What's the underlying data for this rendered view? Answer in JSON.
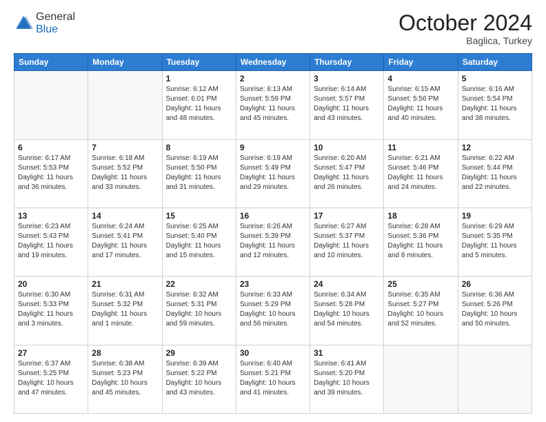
{
  "header": {
    "logo_general": "General",
    "logo_blue": "Blue",
    "month_title": "October 2024",
    "subtitle": "Baglica, Turkey"
  },
  "days_of_week": [
    "Sunday",
    "Monday",
    "Tuesday",
    "Wednesday",
    "Thursday",
    "Friday",
    "Saturday"
  ],
  "weeks": [
    [
      {
        "day": "",
        "sunrise": "",
        "sunset": "",
        "daylight": ""
      },
      {
        "day": "",
        "sunrise": "",
        "sunset": "",
        "daylight": ""
      },
      {
        "day": "1",
        "sunrise": "Sunrise: 6:12 AM",
        "sunset": "Sunset: 6:01 PM",
        "daylight": "Daylight: 11 hours and 48 minutes."
      },
      {
        "day": "2",
        "sunrise": "Sunrise: 6:13 AM",
        "sunset": "Sunset: 5:59 PM",
        "daylight": "Daylight: 11 hours and 45 minutes."
      },
      {
        "day": "3",
        "sunrise": "Sunrise: 6:14 AM",
        "sunset": "Sunset: 5:57 PM",
        "daylight": "Daylight: 11 hours and 43 minutes."
      },
      {
        "day": "4",
        "sunrise": "Sunrise: 6:15 AM",
        "sunset": "Sunset: 5:56 PM",
        "daylight": "Daylight: 11 hours and 40 minutes."
      },
      {
        "day": "5",
        "sunrise": "Sunrise: 6:16 AM",
        "sunset": "Sunset: 5:54 PM",
        "daylight": "Daylight: 11 hours and 38 minutes."
      }
    ],
    [
      {
        "day": "6",
        "sunrise": "Sunrise: 6:17 AM",
        "sunset": "Sunset: 5:53 PM",
        "daylight": "Daylight: 11 hours and 36 minutes."
      },
      {
        "day": "7",
        "sunrise": "Sunrise: 6:18 AM",
        "sunset": "Sunset: 5:52 PM",
        "daylight": "Daylight: 11 hours and 33 minutes."
      },
      {
        "day": "8",
        "sunrise": "Sunrise: 6:19 AM",
        "sunset": "Sunset: 5:50 PM",
        "daylight": "Daylight: 11 hours and 31 minutes."
      },
      {
        "day": "9",
        "sunrise": "Sunrise: 6:19 AM",
        "sunset": "Sunset: 5:49 PM",
        "daylight": "Daylight: 11 hours and 29 minutes."
      },
      {
        "day": "10",
        "sunrise": "Sunrise: 6:20 AM",
        "sunset": "Sunset: 5:47 PM",
        "daylight": "Daylight: 11 hours and 26 minutes."
      },
      {
        "day": "11",
        "sunrise": "Sunrise: 6:21 AM",
        "sunset": "Sunset: 5:46 PM",
        "daylight": "Daylight: 11 hours and 24 minutes."
      },
      {
        "day": "12",
        "sunrise": "Sunrise: 6:22 AM",
        "sunset": "Sunset: 5:44 PM",
        "daylight": "Daylight: 11 hours and 22 minutes."
      }
    ],
    [
      {
        "day": "13",
        "sunrise": "Sunrise: 6:23 AM",
        "sunset": "Sunset: 5:43 PM",
        "daylight": "Daylight: 11 hours and 19 minutes."
      },
      {
        "day": "14",
        "sunrise": "Sunrise: 6:24 AM",
        "sunset": "Sunset: 5:41 PM",
        "daylight": "Daylight: 11 hours and 17 minutes."
      },
      {
        "day": "15",
        "sunrise": "Sunrise: 6:25 AM",
        "sunset": "Sunset: 5:40 PM",
        "daylight": "Daylight: 11 hours and 15 minutes."
      },
      {
        "day": "16",
        "sunrise": "Sunrise: 6:26 AM",
        "sunset": "Sunset: 5:39 PM",
        "daylight": "Daylight: 11 hours and 12 minutes."
      },
      {
        "day": "17",
        "sunrise": "Sunrise: 6:27 AM",
        "sunset": "Sunset: 5:37 PM",
        "daylight": "Daylight: 11 hours and 10 minutes."
      },
      {
        "day": "18",
        "sunrise": "Sunrise: 6:28 AM",
        "sunset": "Sunset: 5:36 PM",
        "daylight": "Daylight: 11 hours and 8 minutes."
      },
      {
        "day": "19",
        "sunrise": "Sunrise: 6:29 AM",
        "sunset": "Sunset: 5:35 PM",
        "daylight": "Daylight: 11 hours and 5 minutes."
      }
    ],
    [
      {
        "day": "20",
        "sunrise": "Sunrise: 6:30 AM",
        "sunset": "Sunset: 5:33 PM",
        "daylight": "Daylight: 11 hours and 3 minutes."
      },
      {
        "day": "21",
        "sunrise": "Sunrise: 6:31 AM",
        "sunset": "Sunset: 5:32 PM",
        "daylight": "Daylight: 11 hours and 1 minute."
      },
      {
        "day": "22",
        "sunrise": "Sunrise: 6:32 AM",
        "sunset": "Sunset: 5:31 PM",
        "daylight": "Daylight: 10 hours and 59 minutes."
      },
      {
        "day": "23",
        "sunrise": "Sunrise: 6:33 AM",
        "sunset": "Sunset: 5:29 PM",
        "daylight": "Daylight: 10 hours and 56 minutes."
      },
      {
        "day": "24",
        "sunrise": "Sunrise: 6:34 AM",
        "sunset": "Sunset: 5:28 PM",
        "daylight": "Daylight: 10 hours and 54 minutes."
      },
      {
        "day": "25",
        "sunrise": "Sunrise: 6:35 AM",
        "sunset": "Sunset: 5:27 PM",
        "daylight": "Daylight: 10 hours and 52 minutes."
      },
      {
        "day": "26",
        "sunrise": "Sunrise: 6:36 AM",
        "sunset": "Sunset: 5:26 PM",
        "daylight": "Daylight: 10 hours and 50 minutes."
      }
    ],
    [
      {
        "day": "27",
        "sunrise": "Sunrise: 6:37 AM",
        "sunset": "Sunset: 5:25 PM",
        "daylight": "Daylight: 10 hours and 47 minutes."
      },
      {
        "day": "28",
        "sunrise": "Sunrise: 6:38 AM",
        "sunset": "Sunset: 5:23 PM",
        "daylight": "Daylight: 10 hours and 45 minutes."
      },
      {
        "day": "29",
        "sunrise": "Sunrise: 6:39 AM",
        "sunset": "Sunset: 5:22 PM",
        "daylight": "Daylight: 10 hours and 43 minutes."
      },
      {
        "day": "30",
        "sunrise": "Sunrise: 6:40 AM",
        "sunset": "Sunset: 5:21 PM",
        "daylight": "Daylight: 10 hours and 41 minutes."
      },
      {
        "day": "31",
        "sunrise": "Sunrise: 6:41 AM",
        "sunset": "Sunset: 5:20 PM",
        "daylight": "Daylight: 10 hours and 39 minutes."
      },
      {
        "day": "",
        "sunrise": "",
        "sunset": "",
        "daylight": ""
      },
      {
        "day": "",
        "sunrise": "",
        "sunset": "",
        "daylight": ""
      }
    ]
  ]
}
